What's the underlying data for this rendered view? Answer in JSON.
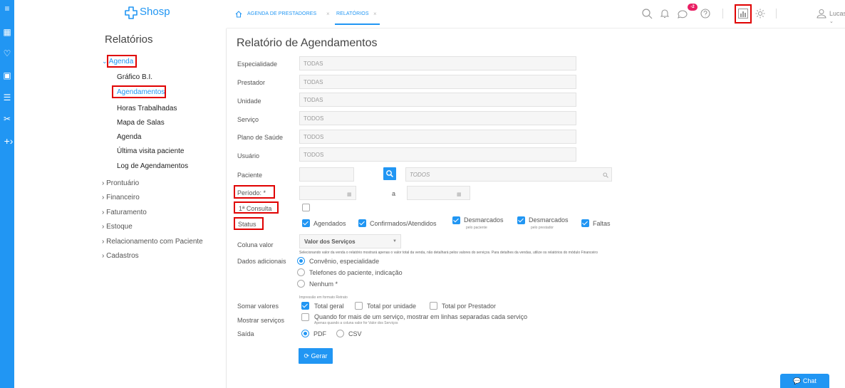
{
  "brand": {
    "name": "Shosp",
    "color": "#2196f3"
  },
  "breadcrumbs": [
    {
      "label": "AGENDA DE PRESTADORES"
    },
    {
      "label": "RELATÓRIOS"
    }
  ],
  "topbar": {
    "notification_count": "-2",
    "user_name": "Lucas"
  },
  "menu": {
    "title": "Relatórios",
    "agenda": {
      "label": "Agenda",
      "items": [
        "Gráfico B.I.",
        "Agendamentos",
        "Horas Trabalhadas",
        "Mapa de Salas",
        "Agenda",
        "Última visita paciente",
        "Log de Agendamentos"
      ]
    },
    "sections": [
      "Prontuário",
      "Financeiro",
      "Faturamento",
      "Estoque",
      "Relacionamento com Paciente",
      "Cadastros"
    ]
  },
  "form": {
    "title": "Relatório de Agendamentos",
    "fields": [
      {
        "label": "Especialidade",
        "value": "TODAS"
      },
      {
        "label": "Prestador",
        "value": "TODAS"
      },
      {
        "label": "Unidade",
        "value": "TODAS"
      },
      {
        "label": "Serviço",
        "value": "TODOS"
      },
      {
        "label": "Plano de Saúde",
        "value": "TODOS"
      },
      {
        "label": "Usuário",
        "value": "TODOS"
      }
    ],
    "paciente": {
      "label": "Paciente",
      "value": "TODOS"
    },
    "periodo": {
      "label": "Período: *",
      "sep": "a"
    },
    "primeira_consulta": {
      "label": "1ª Consulta"
    },
    "status": {
      "label": "Status",
      "options": [
        {
          "label": "Agendados",
          "sub": ""
        },
        {
          "label": "Confirmados/Atendidos",
          "sub": ""
        },
        {
          "label": "Desmarcados",
          "sub": "pelo paciente"
        },
        {
          "label": "Desmarcados",
          "sub": "pelo prestador"
        },
        {
          "label": "Faltas",
          "sub": ""
        }
      ]
    },
    "coluna_valor": {
      "label": "Coluna valor",
      "selected": "Valor dos Serviços",
      "hint": "Selecionando valor da venda o relatório mostrará apenas o valor total da venda, não detalhará pelos valores do serviços. Para detalhes da vendas, utilize os relatórios do módulo Financeiro"
    },
    "dados_adicionais": {
      "label": "Dados adicionais",
      "options": [
        "Convênio, especialidade",
        "Telefones do paciente, indicação",
        "Nenhum *"
      ]
    },
    "somar_valores": {
      "label": "Somar valores",
      "hint": "Impressão em formato Retrato",
      "options": [
        "Total geral",
        "Total por unidade",
        "Total por Prestador"
      ]
    },
    "mostrar_servicos": {
      "label": "Mostrar serviços",
      "option": "Quando for mais de um serviço, mostrar em linhas separadas cada serviço",
      "hint": "Apenas quando a coluna valor for Valor dos Serviços"
    },
    "saida": {
      "label": "Saída",
      "options": [
        "PDF",
        "CSV"
      ]
    },
    "gerar_label": "Gerar"
  },
  "chat_label": "Chat"
}
